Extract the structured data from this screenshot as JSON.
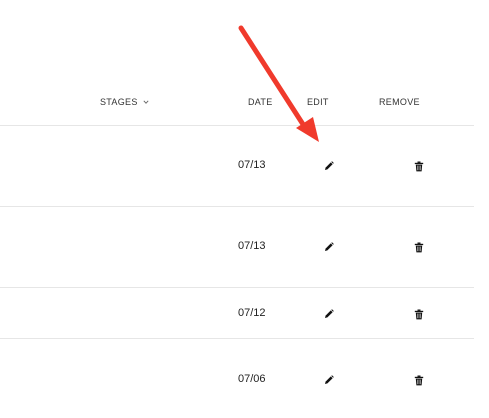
{
  "table": {
    "headers": {
      "stages": "STAGES",
      "date": "DATE",
      "edit": "EDIT",
      "remove": "REMOVE"
    },
    "rows": [
      {
        "date": "07/13"
      },
      {
        "date": "07/13"
      },
      {
        "date": "07/12"
      },
      {
        "date": "07/06"
      }
    ]
  },
  "icons": {
    "stages_sort": "chevron-down-icon",
    "edit": "pencil-icon",
    "remove": "trash-icon"
  },
  "colors": {
    "annotation_arrow": "#f03a2c",
    "divider": "#e6e6e6"
  }
}
